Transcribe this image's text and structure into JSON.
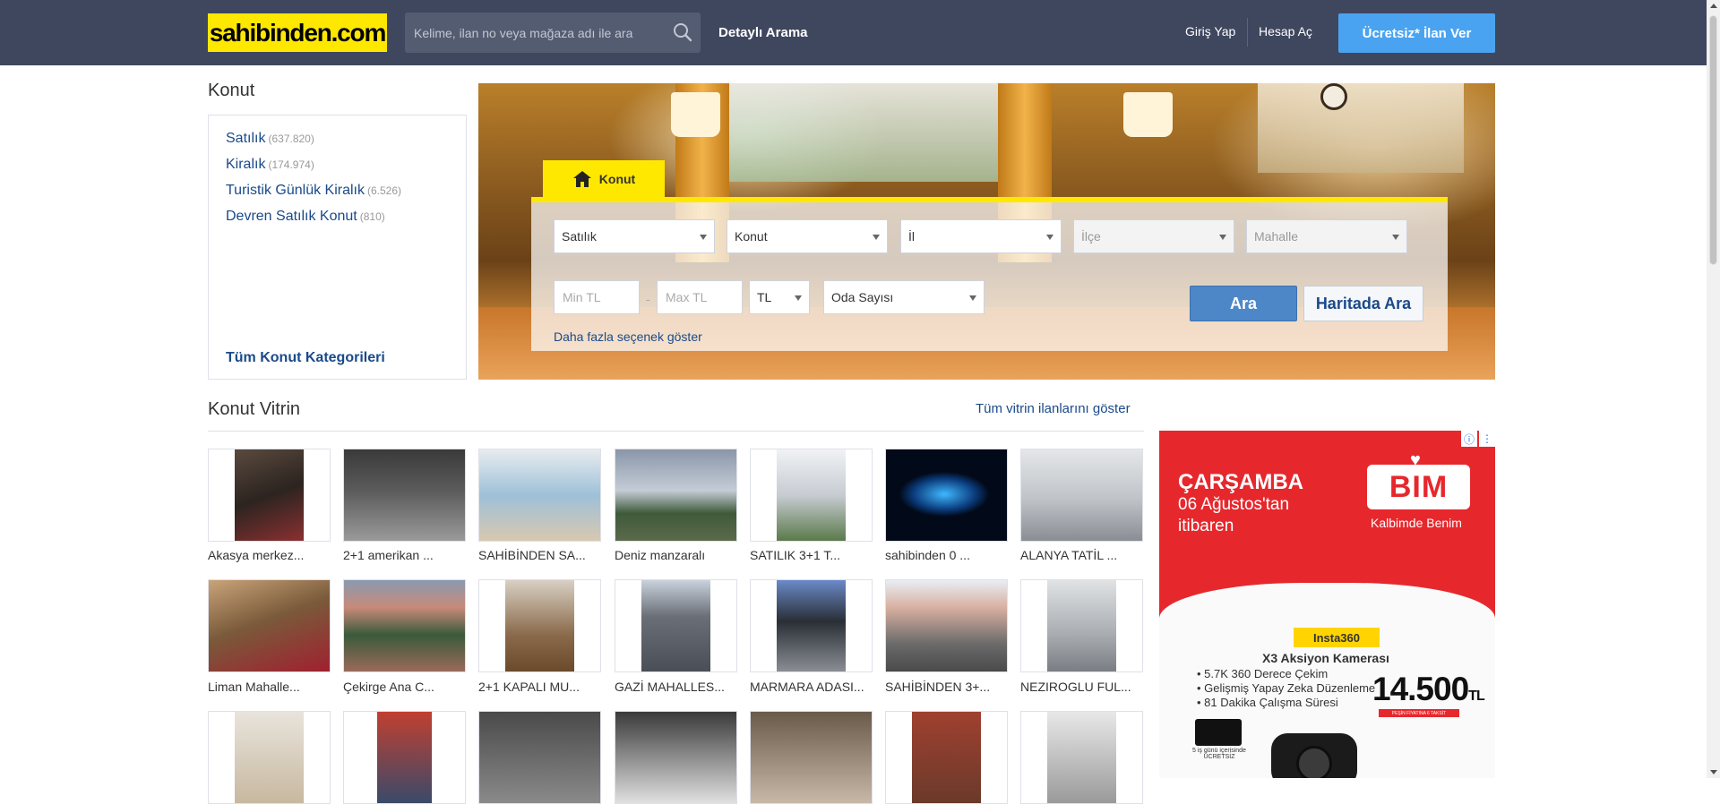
{
  "header": {
    "logo": "sahibinden.com",
    "search_placeholder": "Kelime, ilan no veya mağaza adı ile ara",
    "detailed_search": "Detaylı Arama",
    "login": "Giriş Yap",
    "register": "Hesap Aç",
    "post_ad": "Ücretsiz* İlan Ver"
  },
  "categories": {
    "title": "Konut",
    "items": [
      {
        "label": "Satılık",
        "count": "(637.820)"
      },
      {
        "label": "Kiralık",
        "count": "(174.974)"
      },
      {
        "label": "Turistik Günlük Kiralık",
        "count": "(6.526)"
      },
      {
        "label": "Devren Satılık Konut",
        "count": "(810)"
      }
    ],
    "all_link": "Tüm Konut Kategorileri"
  },
  "search_panel": {
    "tab": "Konut",
    "selects": [
      "Satılık",
      "Konut",
      "İl",
      "İlçe",
      "Mahalle"
    ],
    "min_price_placeholder": "Min TL",
    "max_price_placeholder": "Max TL",
    "dash": "-",
    "currency": "TL",
    "rooms": "Oda Sayısı",
    "search_button": "Ara",
    "map_button": "Haritada Ara",
    "more_options": "Daha fazla seçenek göster"
  },
  "vitrin": {
    "title": "Konut Vitrin",
    "all_link": "Tüm vitrin ilanlarını göster",
    "items": [
      {
        "caption": "Akasya merkez..."
      },
      {
        "caption": "2+1 amerikan ..."
      },
      {
        "caption": "SAHİBİNDEN SA..."
      },
      {
        "caption": "Deniz manzaralı"
      },
      {
        "caption": "SATILIK 3+1 T..."
      },
      {
        "caption": "sahibinden 0 ..."
      },
      {
        "caption": "ALANYA TATİL ..."
      },
      {
        "caption": "Liman Mahalle..."
      },
      {
        "caption": "Çekirge Ana C..."
      },
      {
        "caption": "2+1 KAPALI MU..."
      },
      {
        "caption": "GAZİ MAHALLES..."
      },
      {
        "caption": "MARMARA ADASI..."
      },
      {
        "caption": "SAHİBİNDEN 3+..."
      },
      {
        "caption": "NEZIROGLU FUL..."
      }
    ]
  },
  "ad": {
    "line1": "ÇARŞAMBA",
    "line2": "06 Ağustos'tan",
    "line3": "itibaren",
    "brand": "BIM",
    "slogan": "Kalbimde Benim",
    "badge": "Insta360",
    "product": "X3 Aksiyon Kamerası",
    "features": [
      "• 5.7K 360 Derece Çekim",
      "• Gelişmiş Yapay Zeka Düzenleme",
      "• 81 Dakika Çalışma Süresi"
    ],
    "price": "14.500",
    "price_unit": "TL",
    "installment": "PEŞİN FİYATINA 6 TAKSİT",
    "delivery": "5 iş günü içerisinde ÜCRETSİZ"
  }
}
